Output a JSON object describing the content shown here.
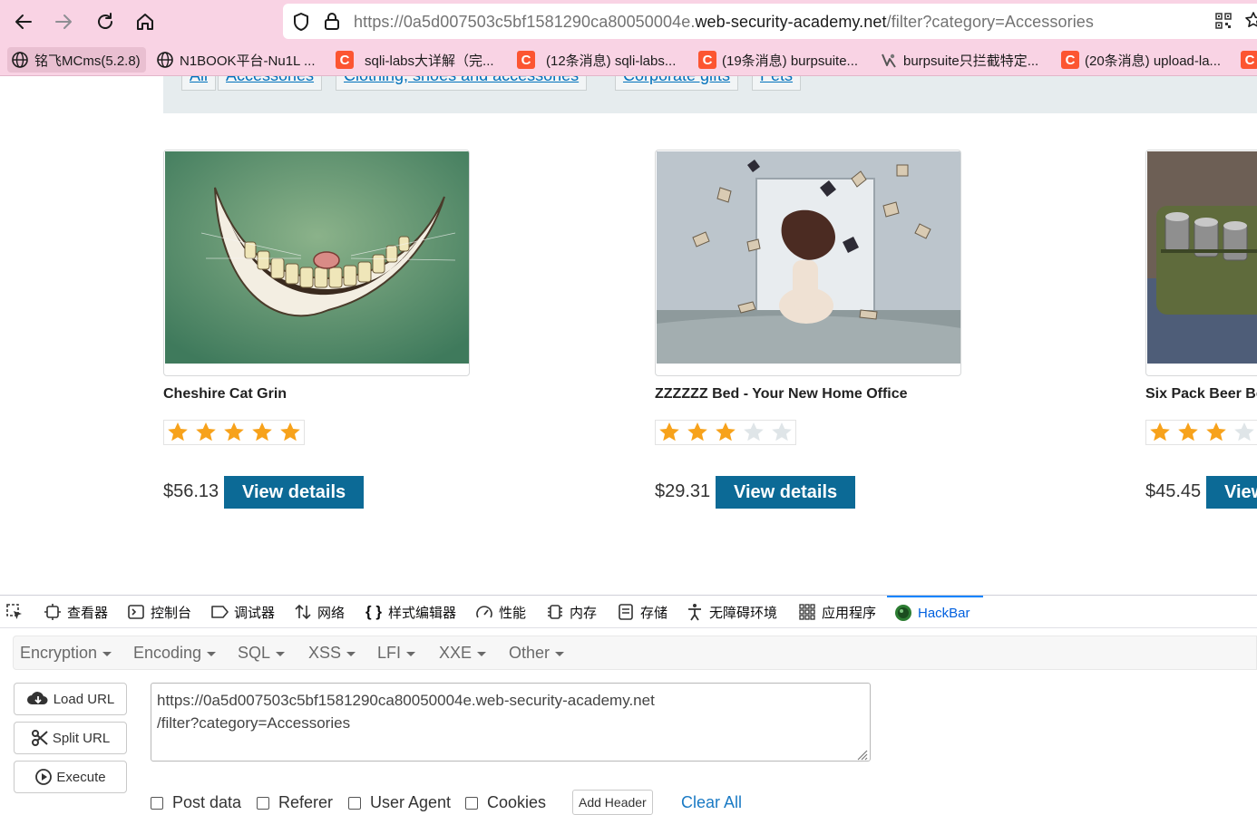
{
  "browser": {
    "url_prefix": "https://0a5d007503c5bf1581290ca80050004e.",
    "url_host": "web-security-academy.net",
    "url_suffix": "/filter?category=Accessories",
    "bookmarks": [
      {
        "label": "铭飞MCms(5.2.8)",
        "icon": "globe-icon"
      },
      {
        "label": "N1BOOK平台-Nu1L ...",
        "icon": "globe-icon"
      },
      {
        "label": "sqli-labs大详解（完...",
        "icon": "csdn-icon"
      },
      {
        "label": "(12条消息) sqli-labs...",
        "icon": "csdn-icon"
      },
      {
        "label": "(19条消息) burpsuite...",
        "icon": "csdn-icon"
      },
      {
        "label": "burpsuite只拦截特定...",
        "icon": "burp-icon"
      },
      {
        "label": "(20条消息) upload-la...",
        "icon": "csdn-icon"
      }
    ]
  },
  "filters": [
    "All",
    "Accessories",
    "Clothing, shoes and accessories",
    "Corporate gifts",
    "Pets"
  ],
  "products": [
    {
      "title": "Cheshire Cat Grin",
      "rating": 5,
      "price": "$56.13",
      "button": "View details"
    },
    {
      "title": "ZZZZZZ Bed - Your New Home Office",
      "rating": 3,
      "price": "$29.31",
      "button": "View details"
    },
    {
      "title": "Six Pack Beer Belt",
      "rating": 3,
      "price": "$45.45",
      "button": "View details"
    }
  ],
  "devtools": {
    "tabs": [
      "查看器",
      "控制台",
      "调试器",
      "网络",
      "样式编辑器",
      "性能",
      "内存",
      "存储",
      "无障碍环境",
      "应用程序",
      "HackBar"
    ],
    "active_tab": "HackBar"
  },
  "hackbar": {
    "menu": [
      "Encryption",
      "Encoding",
      "SQL",
      "XSS",
      "LFI",
      "XXE",
      "Other"
    ],
    "buttons": [
      "Load URL",
      "Split URL",
      "Execute"
    ],
    "url_line1": "https://0a5d007503c5bf1581290ca80050004e.web-security-academy.net",
    "url_line2": "/filter?category=Accessories",
    "checks": [
      "Post data",
      "Referer",
      "User Agent",
      "Cookies"
    ],
    "add_header": "Add Header",
    "clear_all": "Clear All"
  },
  "colors": {
    "accent_button": "#0c6a96",
    "star_on": "#f7a21b",
    "star_off": "#dfe5e8",
    "chrome": "#f9d3e4",
    "link": "#0071bc"
  }
}
